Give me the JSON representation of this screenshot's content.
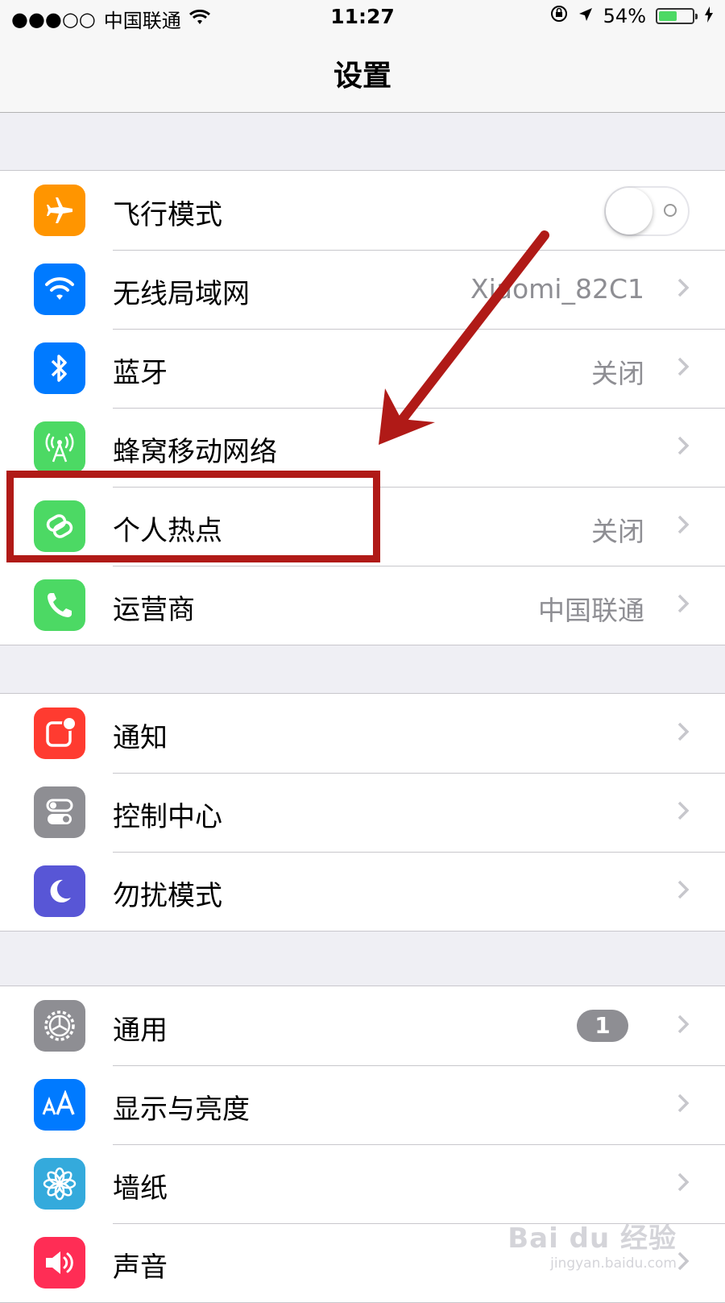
{
  "status_bar": {
    "signal": "●●●○○",
    "carrier": "中国联通",
    "wifi_icon": "wifi-icon",
    "time": "11:27",
    "battery_percent": "54%",
    "battery_level": 0.54,
    "battery_color": "#4cd964"
  },
  "nav": {
    "title": "设置"
  },
  "groups": [
    {
      "rows": [
        {
          "label": "飞行模式",
          "icon": "airplane-icon",
          "icon_color": "#ff9500",
          "control": "toggle",
          "toggle_on": false
        },
        {
          "label": "无线局域网",
          "icon": "wifi-icon",
          "icon_color": "#007aff",
          "value": "Xiaomi_82C1"
        },
        {
          "label": "蓝牙",
          "icon": "bluetooth-icon",
          "icon_color": "#007aff",
          "value": "关闭"
        },
        {
          "label": "蜂窝移动网络",
          "icon": "cellular-icon",
          "icon_color": "#4cd964",
          "value": ""
        },
        {
          "label": "个人热点",
          "icon": "hotspot-icon",
          "icon_color": "#4cd964",
          "value": "关闭"
        },
        {
          "label": "运营商",
          "icon": "phone-icon",
          "icon_color": "#4cd964",
          "value": "中国联通"
        }
      ]
    },
    {
      "rows": [
        {
          "label": "通知",
          "icon": "notification-icon",
          "icon_color": "#ff3b30"
        },
        {
          "label": "控制中心",
          "icon": "control-center-icon",
          "icon_color": "#8e8e93"
        },
        {
          "label": "勿扰模式",
          "icon": "moon-icon",
          "icon_color": "#5856d6"
        }
      ]
    },
    {
      "rows": [
        {
          "label": "通用",
          "icon": "gear-icon",
          "icon_color": "#8e8e93",
          "badge": "1"
        },
        {
          "label": "显示与亮度",
          "icon": "display-icon",
          "icon_color": "#007aff"
        },
        {
          "label": "墙纸",
          "icon": "wallpaper-icon",
          "icon_color": "#34aadc"
        },
        {
          "label": "声音",
          "icon": "sound-icon",
          "icon_color": "#ff2d55"
        }
      ]
    }
  ],
  "annotation": {
    "color": "#b01a17"
  },
  "watermark": {
    "logo": "Bai du 经验",
    "url": "jingyan.baidu.com"
  }
}
